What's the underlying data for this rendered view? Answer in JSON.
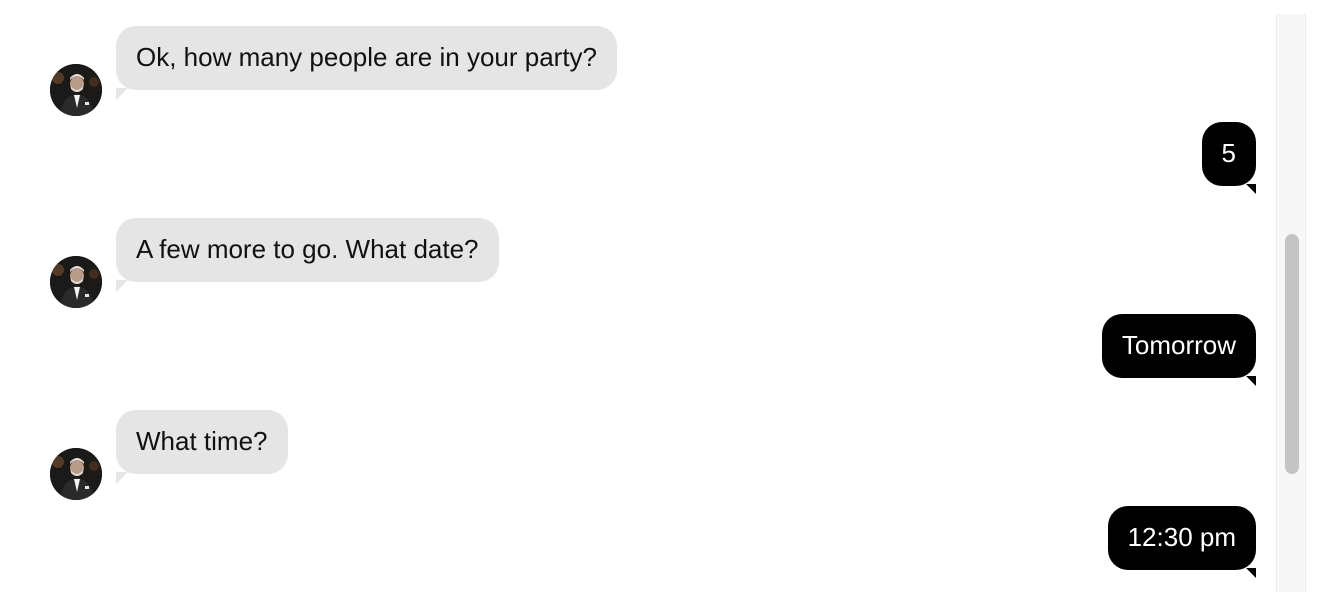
{
  "conversation": {
    "messages": [
      {
        "sender": "bot",
        "text": "Ok, how many people are in your party?"
      },
      {
        "sender": "user",
        "text": "5"
      },
      {
        "sender": "bot",
        "text": "A few more to go. What date?"
      },
      {
        "sender": "user",
        "text": "Tomorrow"
      },
      {
        "sender": "bot",
        "text": "What time?"
      },
      {
        "sender": "user",
        "text": "12:30 pm"
      }
    ]
  },
  "colors": {
    "bot_bubble": "#e5e5e5",
    "bot_text": "#111111",
    "user_bubble": "#000000",
    "user_text": "#ffffff",
    "scrollbar_thumb": "#c4c4c4"
  },
  "icons": {
    "avatar": "bot-avatar-photo"
  }
}
